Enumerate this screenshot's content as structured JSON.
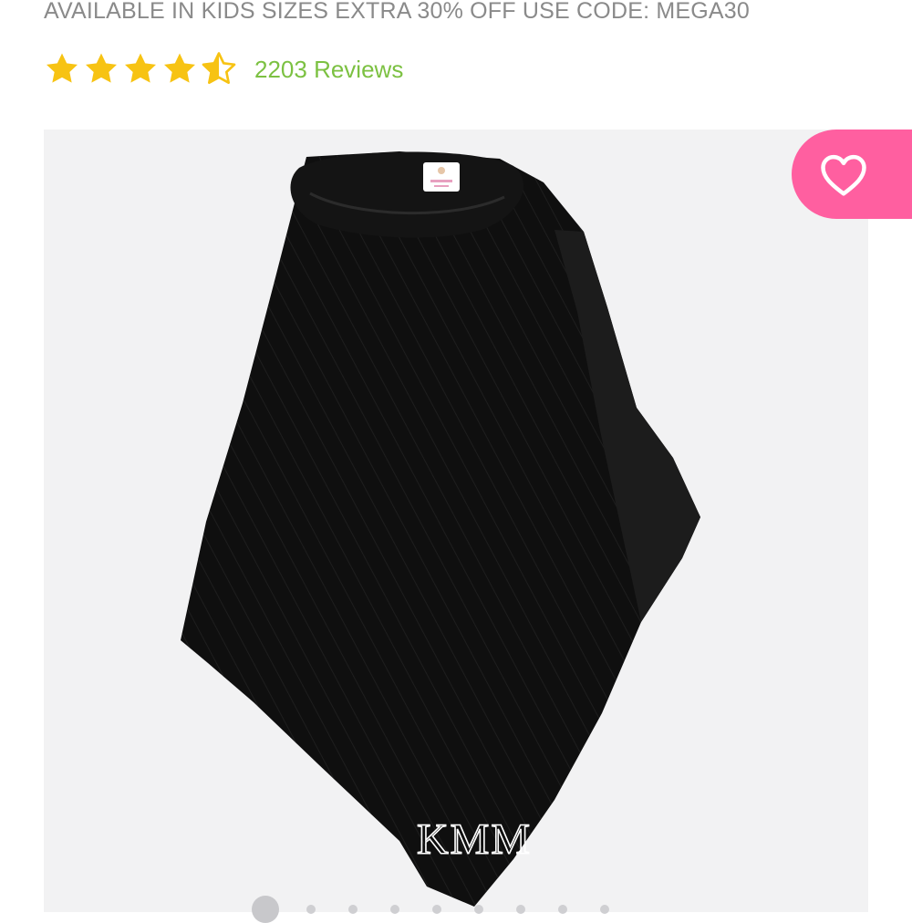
{
  "promo": {
    "text": "AVAILABLE IN KIDS SIZES EXTRA 30% OFF USE CODE: MEGA30"
  },
  "rating": {
    "stars": 4.5,
    "max_stars": 5,
    "reviews_label": "2203 Reviews"
  },
  "product": {
    "image": "black-cable-knit-poncho",
    "monogram": "KMM"
  },
  "favorite": {
    "icon": "heart-outline-icon"
  },
  "carousel": {
    "count": 9,
    "active_index": 0
  },
  "colors": {
    "promo_text": "#8a8a8a",
    "star": "#f7c313",
    "reviews_link": "#7cc142",
    "favorite_bg": "#ff5fa0",
    "gallery_bg": "#f2f2f3"
  }
}
